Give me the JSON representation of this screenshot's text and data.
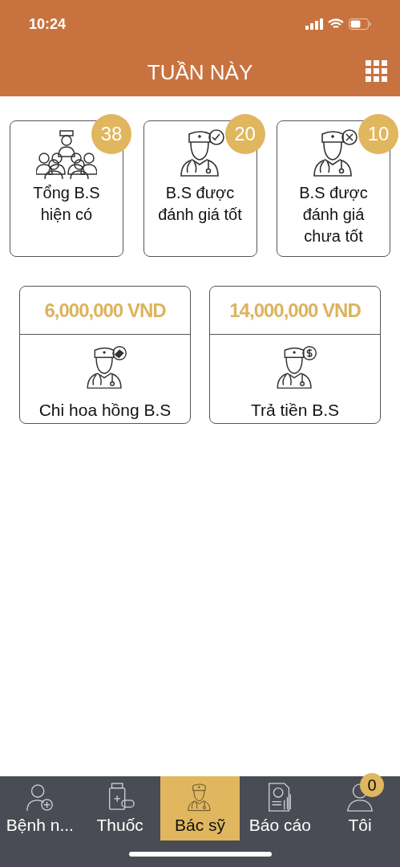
{
  "status_bar": {
    "time": "10:24"
  },
  "header": {
    "title": "TUẦN NÀY"
  },
  "stat_cards": [
    {
      "kind": "group",
      "count": "38",
      "label": "Tổng B.S hiện có"
    },
    {
      "kind": "check",
      "count": "20",
      "label": "B.S được đánh giá tốt"
    },
    {
      "kind": "cross",
      "count": "10",
      "label": "B.S được đánh giá chưa tốt"
    }
  ],
  "money_cards": [
    {
      "kind": "commission",
      "amount": "6,000,000 VND",
      "label": "Chi hoa hồng B.S"
    },
    {
      "kind": "dollar",
      "amount": "14,000,000 VND",
      "label": "Trả tiền B.S"
    }
  ],
  "tab_bar": [
    {
      "kind": "patient",
      "label": "Bệnh n...",
      "selected": false
    },
    {
      "kind": "medicine",
      "label": "Thuốc",
      "selected": false
    },
    {
      "kind": "doctor",
      "label": "Bác sỹ",
      "selected": true
    },
    {
      "kind": "report",
      "label": "Báo cáo",
      "selected": false
    },
    {
      "kind": "person",
      "label": "Tôi",
      "selected": false,
      "badge": "0"
    }
  ]
}
